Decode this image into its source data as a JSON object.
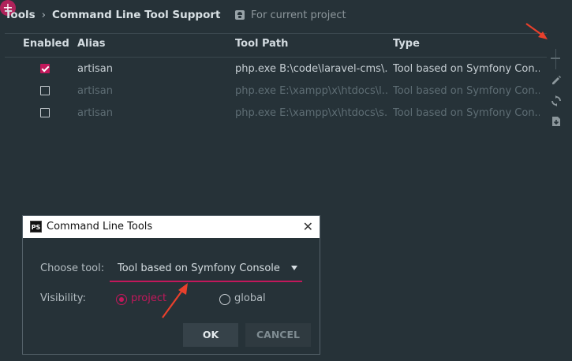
{
  "breadcrumb": {
    "parent": "Tools",
    "separator": "›",
    "current": "Command Line Tool Support"
  },
  "scope": {
    "label": "For current project",
    "icon": "project-scope-icon"
  },
  "table": {
    "headers": {
      "enabled": "Enabled",
      "alias": "Alias",
      "tool_path": "Tool Path",
      "type": "Type"
    },
    "rows": [
      {
        "enabled": true,
        "alias": "artisan",
        "tool_path": "php.exe B:\\code\\laravel-cms\\...",
        "type": "Tool based on Symfony Con..."
      },
      {
        "enabled": false,
        "alias": "artisan",
        "tool_path": "php.exe E:\\xampp\\x\\htdocs\\l...",
        "type": "Tool based on Symfony Con..."
      },
      {
        "enabled": false,
        "alias": "artisan",
        "tool_path": "php.exe E:\\xampp\\x\\htdocs\\s...",
        "type": "Tool based on Symfony Con..."
      }
    ]
  },
  "toolbar": {
    "add": "+",
    "icons": [
      "add-icon",
      "remove-icon",
      "edit-icon",
      "refresh-icon",
      "import-icon"
    ]
  },
  "dialog": {
    "title": "Command Line Tools",
    "logo": "PS",
    "close": "✕",
    "choose_tool_label": "Choose tool:",
    "choose_tool_value": "Tool based on Symfony Console",
    "visibility_label": "Visibility:",
    "visibility_options": [
      "project",
      "global"
    ],
    "visibility_selected": "project",
    "ok_label": "OK",
    "cancel_label": "CANCEL"
  },
  "colors": {
    "background": "#263238",
    "accent": "#c2185b",
    "annotation_arrow": "#e8402c"
  }
}
